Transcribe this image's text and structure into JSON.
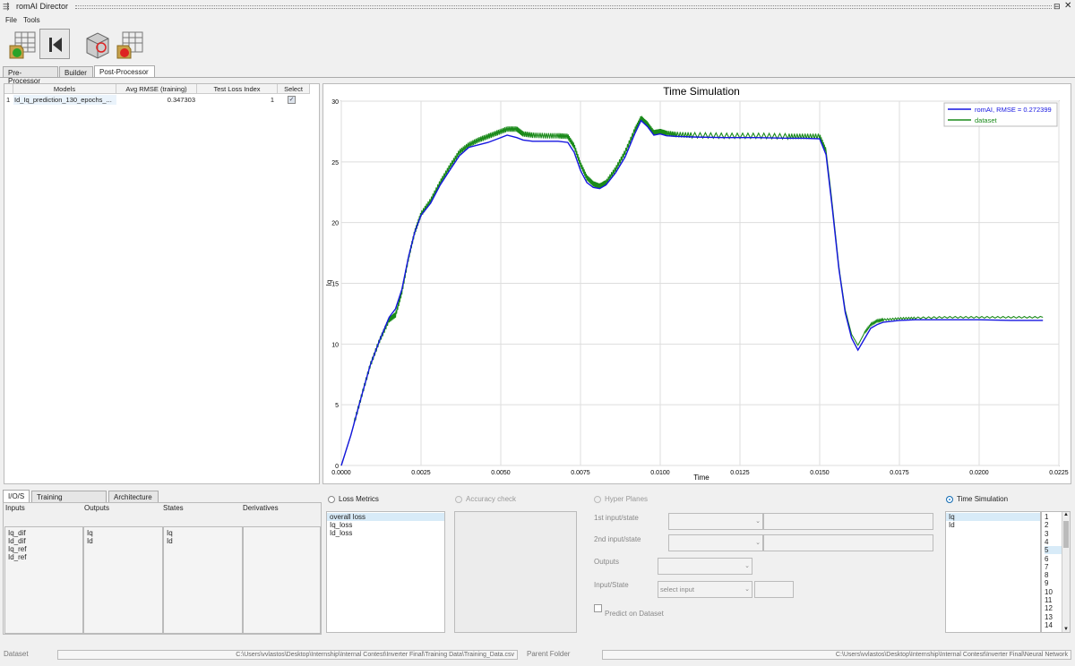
{
  "window": {
    "title": "romAI Director"
  },
  "menu": {
    "file": "File",
    "tools": "Tools"
  },
  "tabs": {
    "pre": "Pre-Processor",
    "builder": "Builder",
    "post": "Post-Processor"
  },
  "models_table": {
    "headers": [
      "Models",
      "Avg RMSE (training)",
      "Test Loss Index",
      "Select"
    ],
    "rows": [
      {
        "index": "1",
        "model": "Id_Iq_prediction_130_epochs_...",
        "rmse": "0.347303",
        "test_loss": "1",
        "selected": true
      }
    ]
  },
  "chart_data": {
    "type": "line",
    "title": "Time Simulation",
    "xlabel": "Time",
    "ylabel": "Iq",
    "xlim": [
      0,
      0.0225
    ],
    "ylim": [
      0,
      30
    ],
    "xticks": [
      "0.0000",
      "0.0025",
      "0.0050",
      "0.0075",
      "0.0100",
      "0.0125",
      "0.0150",
      "0.0175",
      "0.0200",
      "0.0225"
    ],
    "yticks": [
      "0",
      "5",
      "10",
      "15",
      "20",
      "25",
      "30"
    ],
    "grid": true,
    "legend_position": "top-right",
    "series": [
      {
        "name": "romAI, RMSE = 0.272399",
        "color": "#1515e0",
        "x": [
          0,
          0.0003,
          0.0006,
          0.0009,
          0.0012,
          0.0015,
          0.0017,
          0.0019,
          0.0021,
          0.0023,
          0.0025,
          0.0028,
          0.0031,
          0.0034,
          0.0037,
          0.004,
          0.0043,
          0.0046,
          0.0049,
          0.0052,
          0.0055,
          0.0057,
          0.006,
          0.0064,
          0.0068,
          0.0071,
          0.0073,
          0.0075,
          0.0077,
          0.0079,
          0.0081,
          0.0083,
          0.0086,
          0.0089,
          0.0092,
          0.0094,
          0.0096,
          0.0098,
          0.01,
          0.0102,
          0.0105,
          0.011,
          0.012,
          0.013,
          0.014,
          0.0145,
          0.015,
          0.0152,
          0.0154,
          0.0156,
          0.0158,
          0.016,
          0.0162,
          0.0164,
          0.0166,
          0.0168,
          0.017,
          0.0175,
          0.018,
          0.019,
          0.02,
          0.021,
          0.022
        ],
        "y": [
          0,
          2.5,
          5.4,
          8.2,
          10.3,
          12.2,
          12.9,
          14.5,
          17.1,
          19.2,
          20.6,
          21.6,
          23.1,
          24.3,
          25.5,
          26.2,
          26.4,
          26.6,
          26.9,
          27.2,
          27,
          26.8,
          26.7,
          26.7,
          26.7,
          26.6,
          25.8,
          24.3,
          23.3,
          22.9,
          22.8,
          23.1,
          24.1,
          25.4,
          27.3,
          28.4,
          27.9,
          27.2,
          27.3,
          27.15,
          27.1,
          27.05,
          27.0,
          27.0,
          26.95,
          26.95,
          26.9,
          25.6,
          21.1,
          16.2,
          12.6,
          10.5,
          9.5,
          10.4,
          11.3,
          11.6,
          11.8,
          11.95,
          12.0,
          12.0,
          12.0,
          11.95,
          11.95
        ]
      },
      {
        "name": "dataset",
        "color": "#1a8a1a",
        "x": [
          0,
          0.0003,
          0.0006,
          0.0009,
          0.0012,
          0.0015,
          0.0017,
          0.0019,
          0.0021,
          0.0023,
          0.0025,
          0.0028,
          0.0031,
          0.0034,
          0.0037,
          0.004,
          0.0043,
          0.0046,
          0.0049,
          0.0052,
          0.0055,
          0.0057,
          0.006,
          0.0064,
          0.0068,
          0.0071,
          0.0073,
          0.0075,
          0.0077,
          0.0079,
          0.0081,
          0.0083,
          0.0086,
          0.0089,
          0.0092,
          0.0094,
          0.0096,
          0.0098,
          0.01,
          0.0102,
          0.0105,
          0.011,
          0.012,
          0.013,
          0.014,
          0.0145,
          0.015,
          0.0152,
          0.0154,
          0.0156,
          0.0158,
          0.016,
          0.0162,
          0.0164,
          0.0166,
          0.0168,
          0.017,
          0.0175,
          0.018,
          0.019,
          0.02,
          0.021,
          0.022
        ],
        "y": [
          0,
          2.5,
          5.4,
          8.2,
          10.3,
          12.0,
          12.4,
          14.3,
          17.0,
          19.2,
          20.7,
          21.8,
          23.3,
          24.6,
          25.8,
          26.4,
          26.8,
          27.1,
          27.4,
          27.7,
          27.7,
          27.3,
          27.2,
          27.15,
          27.15,
          27.1,
          26.3,
          24.8,
          23.7,
          23.2,
          23.0,
          23.3,
          24.4,
          25.8,
          27.6,
          28.6,
          28.1,
          27.4,
          27.5,
          27.35,
          27.25,
          27.2,
          27.15,
          27.15,
          27.1,
          27.1,
          27.1,
          25.9,
          21.4,
          16.4,
          12.8,
          10.8,
          9.9,
          10.9,
          11.6,
          11.9,
          12.0,
          12.1,
          12.15,
          12.2,
          12.2,
          12.2,
          12.2
        ]
      }
    ]
  },
  "io_tabs": [
    "I/O/S",
    "Training Parameters",
    "Architecture"
  ],
  "io_columns": {
    "inputs": "Inputs",
    "outputs": "Outputs",
    "states": "States",
    "derivatives": "Derivatives"
  },
  "io_lists": {
    "inputs": [
      "Iq_dif",
      "Id_dif",
      "Iq_ref",
      "Id_ref"
    ],
    "outputs": [
      "Iq",
      "Id"
    ],
    "states": [
      "Iq",
      "Id"
    ],
    "derivatives": []
  },
  "loss_metrics": {
    "label": "Loss Metrics",
    "items": [
      "overall loss",
      "Iq_loss",
      "Id_loss"
    ]
  },
  "accuracy": {
    "label": "Accuracy check"
  },
  "hyper_planes": {
    "label": "Hyper Planes",
    "first": "1st input/state",
    "second": "2nd input/state",
    "outputs": "Outputs",
    "input_state": "Input/State",
    "select_placeholder": "select input",
    "predict": "Predict on Dataset"
  },
  "time_sim": {
    "label": "Time Simulation",
    "signals": [
      "Iq",
      "Id"
    ],
    "numbers": [
      "1",
      "2",
      "3",
      "4",
      "5",
      "6",
      "7",
      "8",
      "9",
      "10",
      "11",
      "12",
      "13",
      "14"
    ],
    "selected_number": "5"
  },
  "status": {
    "dataset_label": "Dataset",
    "dataset_path": "C:\\Users\\vvlastos\\Desktop\\Internship\\Internal Contest\\Inverter Final\\Training Data\\Training_Data.csv",
    "parent_label": "Parent Folder",
    "parent_path": "C:\\Users\\vvlastos\\Desktop\\Internship\\Internal Contest\\Inverter Final\\Neural Network"
  }
}
